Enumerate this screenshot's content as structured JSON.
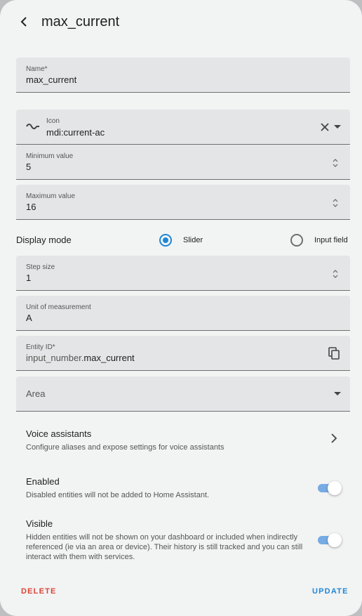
{
  "header": {
    "title": "max_current"
  },
  "form": {
    "name": {
      "label": "Name*",
      "value": "max_current"
    },
    "icon": {
      "label": "Icon",
      "value": "mdi:current-ac"
    },
    "min": {
      "label": "Minimum value",
      "value": "5"
    },
    "max": {
      "label": "Maximum value",
      "value": "16"
    },
    "display_mode": {
      "label": "Display mode",
      "options": [
        {
          "label": "Slider",
          "checked": true
        },
        {
          "label": "Input field",
          "checked": false
        }
      ]
    },
    "step": {
      "label": "Step size",
      "value": "1"
    },
    "unit": {
      "label": "Unit of measurement",
      "value": "A"
    },
    "entity_id": {
      "label": "Entity ID*",
      "prefix": "input_number.",
      "value": "max_current"
    },
    "area": {
      "label": "Area"
    }
  },
  "voice": {
    "title": "Voice assistants",
    "subtitle": "Configure aliases and expose settings for voice assistants"
  },
  "enabled": {
    "title": "Enabled",
    "subtitle": "Disabled entities will not be added to Home Assistant.",
    "on": true
  },
  "visible": {
    "title": "Visible",
    "subtitle": "Hidden entities will not be shown on your dashboard or included when indirectly referenced (ie via an area or device). Their history is still tracked and you can still interact with them with services.",
    "on": true
  },
  "actions": {
    "delete_label": "DELETE",
    "update_label": "UPDATE"
  },
  "colors": {
    "accent": "#1f87d6",
    "danger": "#db4437",
    "toggle_track": "#76abe3",
    "dialog_bg": "#f2f3f3",
    "field_bg": "#e4e5e6"
  }
}
